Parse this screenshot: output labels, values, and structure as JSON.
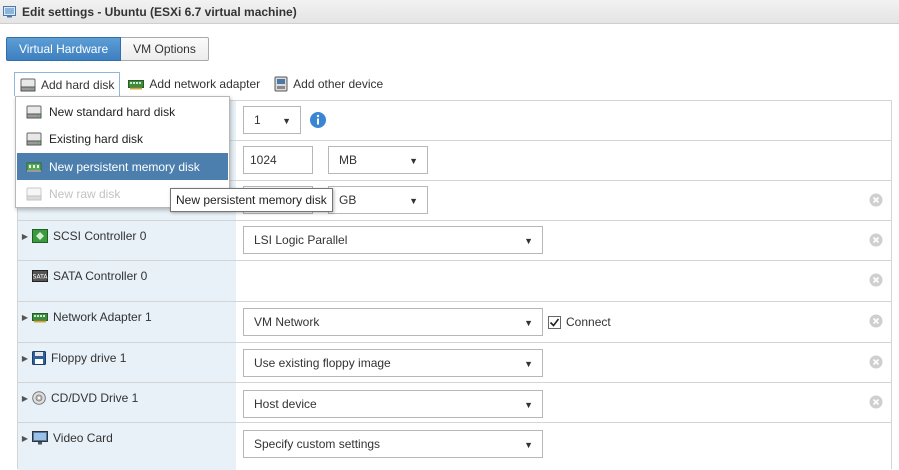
{
  "window": {
    "title": "Edit settings - Ubuntu (ESXi 6.7 virtual machine)",
    "icon": "vm-edit-icon"
  },
  "tabs": [
    {
      "label": "Virtual Hardware",
      "active": true
    },
    {
      "label": "VM Options",
      "active": false
    }
  ],
  "toolbar": {
    "add_hard_disk": "Add hard disk",
    "add_network_adapter": "Add network adapter",
    "add_other_device": "Add other device"
  },
  "dropdown": {
    "items": [
      {
        "label": "New standard hard disk",
        "icon": "hard-disk-icon",
        "state": "normal"
      },
      {
        "label": "Existing hard disk",
        "icon": "hard-disk-icon",
        "state": "normal"
      },
      {
        "label": "New persistent memory disk",
        "icon": "memory-disk-icon",
        "state": "highlighted"
      },
      {
        "label": "New raw disk",
        "icon": "hard-disk-icon",
        "state": "disabled"
      }
    ]
  },
  "tooltip": "New persistent memory disk",
  "rows": {
    "cpu": {
      "value": "1"
    },
    "memory": {
      "value": "1024",
      "unit": "MB"
    },
    "disk": {
      "unit": "GB"
    },
    "scsi": {
      "label": "SCSI Controller 0",
      "value": "LSI Logic Parallel"
    },
    "sata": {
      "label": "SATA Controller 0"
    },
    "network": {
      "label": "Network Adapter 1",
      "value": "VM Network",
      "connect_label": "Connect",
      "connected": true
    },
    "floppy": {
      "label": "Floppy drive 1",
      "value": "Use existing floppy image"
    },
    "cdrom": {
      "label": "CD/DVD Drive 1",
      "value": "Host device"
    },
    "video": {
      "label": "Video Card",
      "value": "Specify custom settings"
    }
  },
  "colors": {
    "accent": "#3d7fc0",
    "highlight": "#4d7fae",
    "label_column": "#e8f1f8",
    "info": "#3b86d4"
  }
}
